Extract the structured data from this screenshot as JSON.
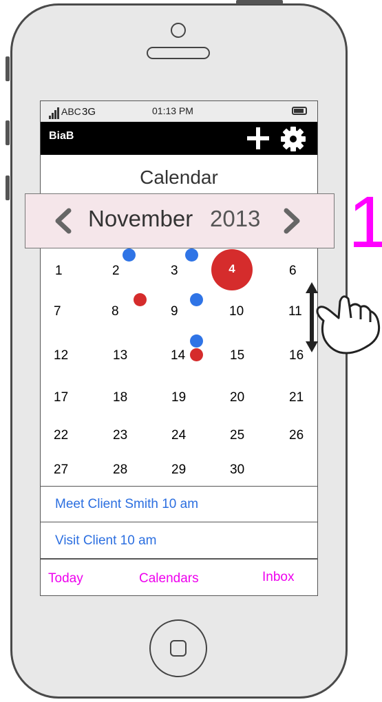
{
  "status_bar": {
    "carrier": "ABC",
    "network": "3G",
    "time": "01:13 PM"
  },
  "app_bar": {
    "title": "BiaB",
    "add_icon": "plus-icon",
    "settings_icon": "gear-icon"
  },
  "calendar": {
    "title": "Calendar",
    "month": "November",
    "year": "2013",
    "selected_day": "4",
    "weeks": [
      [
        "1",
        "2",
        "3",
        "4",
        "6"
      ],
      [
        "7",
        "8",
        "9",
        "10",
        "11"
      ],
      [
        "12",
        "13",
        "14",
        "15",
        "16"
      ],
      [
        "17",
        "18",
        "19",
        "20",
        "21"
      ],
      [
        "22",
        "23",
        "24",
        "25",
        "26"
      ],
      [
        "27",
        "28",
        "29",
        "30"
      ]
    ]
  },
  "events": [
    "Meet Client Smith 10 am",
    "Visit Client 10 am"
  ],
  "tabs": {
    "today": "Today",
    "calendars": "Calendars",
    "inbox": "Inbox"
  },
  "annotation": {
    "number": "1",
    "gesture": "swipe-up-down-hand-icon"
  },
  "colors": {
    "event_dot_blue": "#2f74e6",
    "event_dot_red": "#d52c2c",
    "annotation": "#ff00ff",
    "link_text": "#2c6fe0"
  }
}
